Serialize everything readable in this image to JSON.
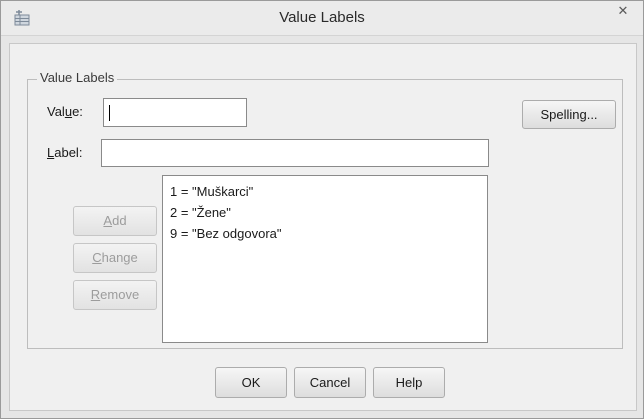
{
  "window": {
    "title": "Value Labels",
    "close_glyph": "✕",
    "app_icon": "spss-table-icon"
  },
  "group": {
    "legend": "Value Labels"
  },
  "value_field": {
    "label_pre": "Val",
    "label_accel": "u",
    "label_post": "e:",
    "value": ""
  },
  "label_field": {
    "label_accel": "L",
    "label_post": "abel:",
    "value": ""
  },
  "spelling_button": {
    "label": "Spelling..."
  },
  "edit_buttons": {
    "add": {
      "label_accel": "A",
      "label_post": "dd"
    },
    "change": {
      "label_accel": "C",
      "label_post": "hange"
    },
    "remove": {
      "label_accel": "R",
      "label_post": "emove"
    }
  },
  "value_labels": [
    {
      "text": "1 = \"Muškarci\""
    },
    {
      "text": "2 = \"Žene\""
    },
    {
      "text": "9 = \"Bez odgovora\""
    }
  ],
  "dialog_buttons": {
    "ok": "OK",
    "cancel": "Cancel",
    "help": "Help"
  }
}
